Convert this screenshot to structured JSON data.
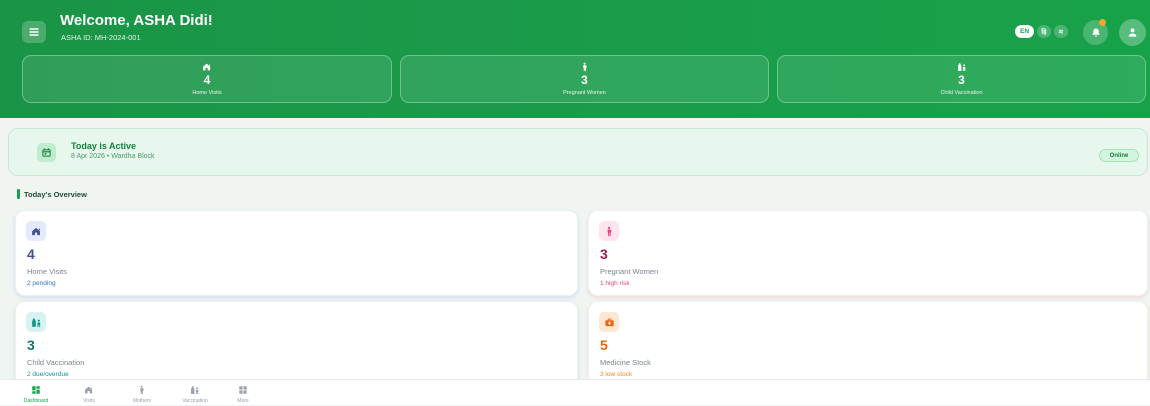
{
  "header": {
    "menu_icon": "menu-icon",
    "title": "Welcome, ASHA Didi!",
    "subtitle": "ASHA ID: MH-2024-001",
    "languages": [
      "EN",
      "हि",
      "म"
    ],
    "active_language_index": 0,
    "notification_icon": "bell-icon",
    "notification_dot": true,
    "profile_icon": "user-icon"
  },
  "stats": [
    {
      "icon": "home-icon",
      "value": "4",
      "label": "Home Visits"
    },
    {
      "icon": "pregnant-woman-icon",
      "value": "3",
      "label": "Pregnant Women"
    },
    {
      "icon": "baby-bottle-icon",
      "value": "3",
      "label": "Child Vaccination"
    }
  ],
  "status": {
    "icon": "calendar-icon",
    "title": "Today is Active",
    "subtitle": "8 Apr 2026 • Wardha Block",
    "badge": "Online"
  },
  "overview": {
    "title": "Today's Overview",
    "cards": [
      {
        "icon": "home-icon",
        "value": "4",
        "label": "Home Visits",
        "note": "2 pending",
        "accent": "#3f4f9a",
        "note_color": "#3274c9",
        "icon_bg": "#e4e9fb"
      },
      {
        "icon": "pregnant-woman-icon",
        "value": "3",
        "label": "Pregnant Women",
        "note": "1 high risk",
        "accent": "#9c1c50",
        "note_color": "#e0457b",
        "icon_bg": "#fde4ee"
      },
      {
        "icon": "baby-bottle-icon",
        "value": "3",
        "label": "Child Vaccination",
        "note": "2 due/overdue",
        "accent": "#13756d",
        "note_color": "#14958a",
        "icon_bg": "#d7f3ef"
      },
      {
        "icon": "medicine-box-icon",
        "value": "5",
        "label": "Medicine Stock",
        "note": "3 low stock",
        "accent": "#e8650f",
        "note_color": "#f08a24",
        "icon_bg": "#fde7d3"
      }
    ]
  },
  "bottom_nav": {
    "active_index": 0,
    "items": [
      {
        "icon": "dashboard-icon",
        "label": "Dashboard"
      },
      {
        "icon": "home-icon",
        "label": "Visits"
      },
      {
        "icon": "pregnant-woman-icon",
        "label": "Mothers"
      },
      {
        "icon": "baby-bottle-icon",
        "label": "Vaccination"
      },
      {
        "icon": "apps-grid-icon",
        "label": "More"
      }
    ]
  },
  "colors": {
    "brand": "#16a34a",
    "notification_dot": "#f5a524"
  }
}
